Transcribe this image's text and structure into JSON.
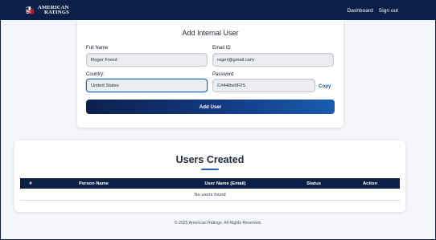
{
  "navbar": {
    "brand_line1": "AMERICAN",
    "brand_line2": "RATINGS",
    "links": [
      "Dashboard",
      "Sign out"
    ]
  },
  "add_user": {
    "title": "Add Internal User",
    "full_name_label": "Full Name",
    "full_name_value": "Roger Frend",
    "email_label": "Email ID",
    "email_value": "roger@gmail.com",
    "country_label": "Country:",
    "country_value": "United States",
    "password_label": "Password",
    "password_value": "C#448w9F2S",
    "copy_label": "Copy",
    "submit_label": "Add User"
  },
  "users": {
    "title": "Users Created",
    "columns": [
      "#",
      "Person Name",
      "User Name (Email)",
      "Status",
      "Action"
    ],
    "empty_text": "No users found"
  },
  "footer": "© 2025 American Ratings. All Rights Reserved.",
  "colors": {
    "navy": "#0c1f46",
    "accent": "#1f67b1",
    "button_end": "#1a5cae"
  }
}
